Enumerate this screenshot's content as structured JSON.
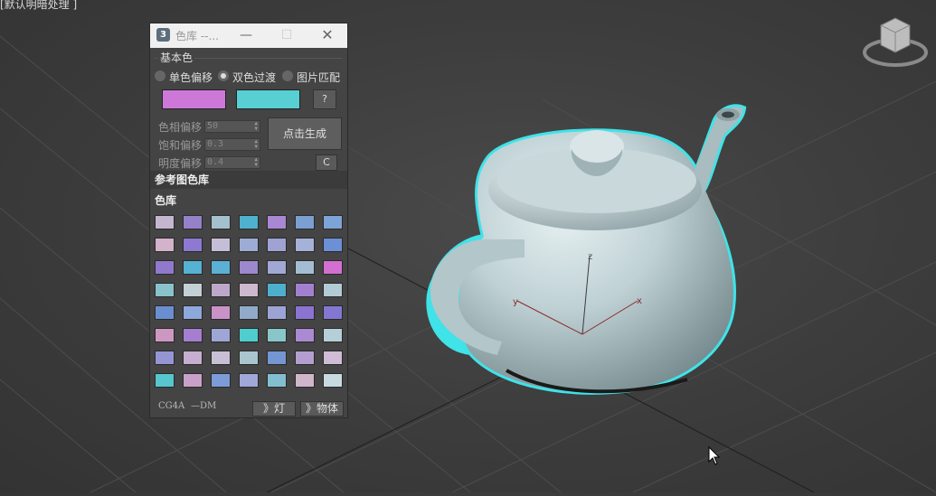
{
  "viewport": {
    "label": "[默认明暗处理 ]",
    "background": "#3c3c3c",
    "object_color": "#c4d6da",
    "selection_outline": "#3fe3e8",
    "axis_labels": {
      "x": "x",
      "y": "y",
      "z": "z"
    }
  },
  "panel": {
    "title": "色库 --...",
    "app_icon": "3",
    "window_controls": {
      "minimize": "—",
      "maximize": "☐",
      "close": "✕"
    },
    "basic_group_label": "基本色",
    "radios": [
      {
        "label": "单色偏移",
        "selected": false
      },
      {
        "label": "双色过渡",
        "selected": true
      },
      {
        "label": "图片匹配",
        "selected": false
      }
    ],
    "swatch1_color": "#cd78d9",
    "swatch2_color": "#58cfd3",
    "help_label": "?",
    "params": [
      {
        "label": "色相偏移",
        "value": "50"
      },
      {
        "label": "饱和偏移",
        "value": "0.3"
      },
      {
        "label": "明度偏移",
        "value": "0.4"
      }
    ],
    "generate_label": "点击生成",
    "clear_label": "C",
    "ref_section": "参考图色库",
    "lib_section": "色库",
    "swatches": [
      [
        "#c5b6d0",
        "#9581c9",
        "#a3c1cd",
        "#4fb1ce",
        "#a888d2",
        "#7c9fd1",
        "#7ea3d6"
      ],
      [
        "#d3b2cb",
        "#8d79d2",
        "#c6bed6",
        "#9cacd4",
        "#9fa2d3",
        "#a6b1d8",
        "#6c8fd5"
      ],
      [
        "#9079cd",
        "#56b1d2",
        "#5cb0d4",
        "#9b88cd",
        "#a1a8d4",
        "#a5bdd2",
        "#d26fd1"
      ],
      [
        "#8ac2cc",
        "#c3d0d6",
        "#bda8c9",
        "#cdb8ce",
        "#4eafcd",
        "#a380cf",
        "#b2cbd4"
      ],
      [
        "#6a8fd0",
        "#8da8da",
        "#c993c7",
        "#91aac9",
        "#9da3d4",
        "#8b74d1",
        "#8377d2"
      ],
      [
        "#cc98c2",
        "#a57ed0",
        "#9ea6d6",
        "#4fcdcf",
        "#89c6ca",
        "#ab89d3",
        "#b5ced7"
      ],
      [
        "#9595d4",
        "#c6aed1",
        "#c9bfd5",
        "#a9c6cf",
        "#7497d4",
        "#b29fcf",
        "#d0bcd4"
      ],
      [
        "#55c7cd",
        "#c9a1c8",
        "#7c9bd7",
        "#a0a8d8",
        "#83bed0",
        "#d0b6c9",
        "#c7dae1"
      ]
    ],
    "footer_text": "CG4A",
    "footer_suffix": "—DM",
    "light_button": "》灯",
    "object_button": "》物体"
  }
}
